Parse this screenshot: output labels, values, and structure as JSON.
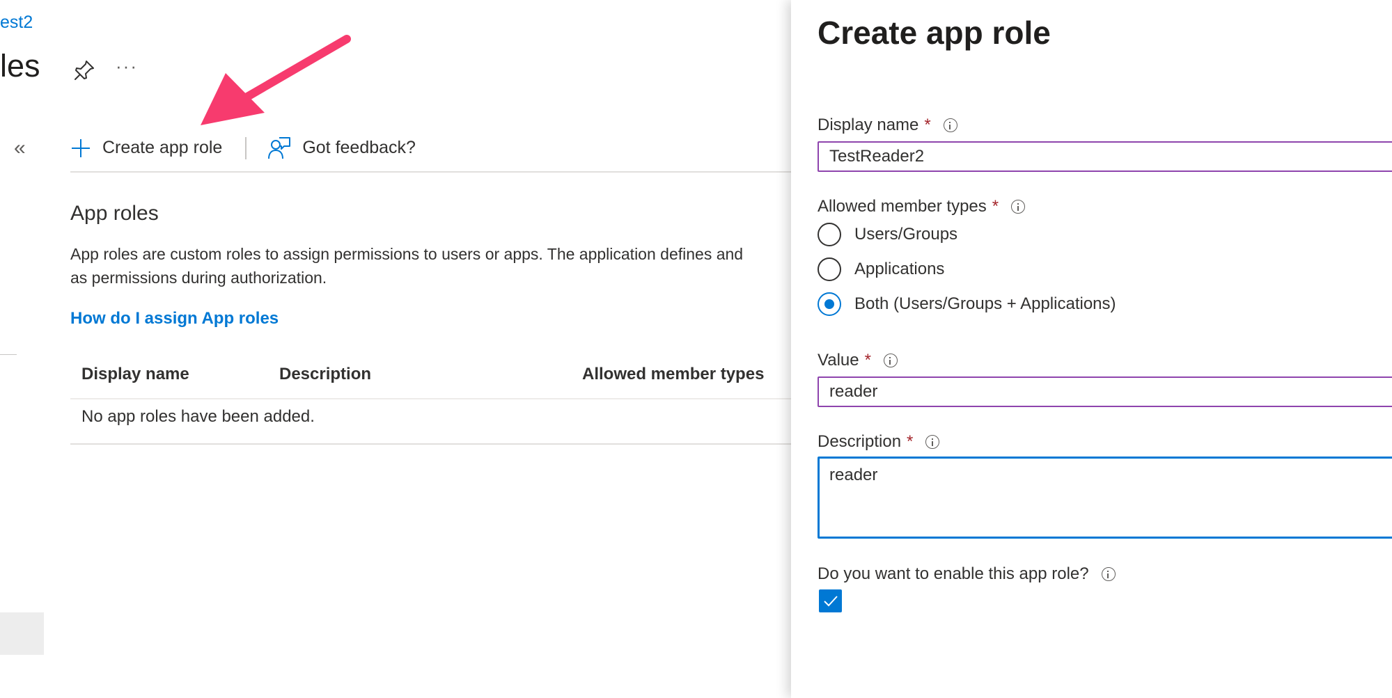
{
  "breadcrumb": {
    "text": "est2"
  },
  "page": {
    "title_fragment": "les"
  },
  "command_bar": {
    "create_label": "Create app role",
    "feedback_label": "Got feedback?"
  },
  "app_roles": {
    "title": "App roles",
    "description_line1": "App roles are custom roles to assign permissions to users or apps. The application defines and",
    "description_line2": "as permissions during authorization.",
    "help_link": "How do I assign App roles",
    "table": {
      "columns": [
        "Display name",
        "Description",
        "Allowed member types"
      ],
      "empty_text": "No app roles have been added."
    }
  },
  "panel": {
    "title": "Create app role",
    "display_name": {
      "label": "Display name",
      "required": "*",
      "value": "TestReader2"
    },
    "member_types": {
      "label": "Allowed member types",
      "required": "*",
      "options": [
        "Users/Groups",
        "Applications",
        "Both (Users/Groups + Applications)"
      ],
      "selected": "Both (Users/Groups + Applications)"
    },
    "value_field": {
      "label": "Value",
      "required": "*",
      "value": "reader"
    },
    "description_field": {
      "label": "Description",
      "required": "*",
      "value": "reader"
    },
    "enable": {
      "label": "Do you want to enable this app role?",
      "checked": true
    }
  },
  "icons": {
    "pin": "pin-icon",
    "more": "more-icon",
    "collapse": "double-chevron-left-icon",
    "add": "plus-icon",
    "feedback": "feedback-icon",
    "info": "info-icon",
    "arrow": "annotation-arrow",
    "check": "checkmark-icon"
  },
  "colors": {
    "accent": "#0078d4",
    "annotation_arrow": "#f73b6e",
    "required": "#a4262c",
    "field_border": "#8e44ad"
  }
}
